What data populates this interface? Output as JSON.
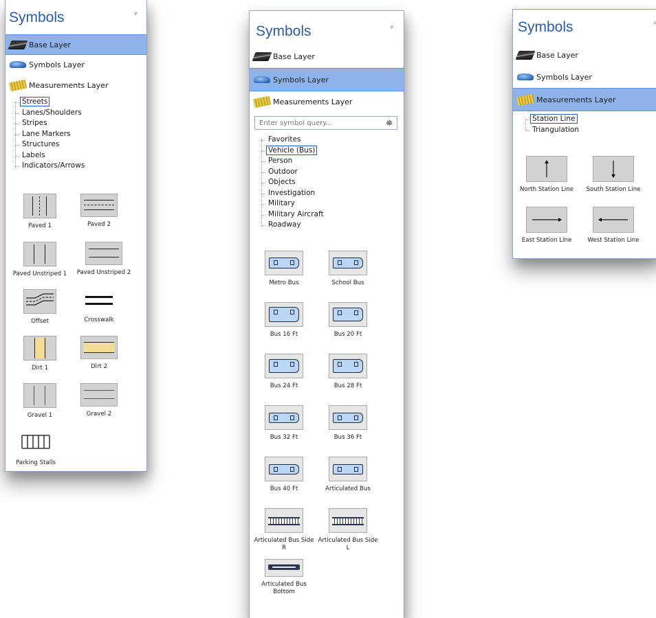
{
  "panel_left": {
    "title": "Symbols",
    "pin": "ᵖ",
    "layers": [
      "Base Layer",
      "Symbols Layer",
      "Measurements Layer"
    ],
    "selected_layer": "Base Layer",
    "tree": [
      "Streets",
      "Lanes/Shoulders",
      "Stripes",
      "Lane Markers",
      "Structures",
      "Labels",
      "Indicators/Arrows"
    ],
    "highlighted_item": "Streets",
    "symbols": [
      "Paved 1",
      "Paved 2",
      "Paved Unstriped 1",
      "Paved Unstriped 2",
      "Offset",
      "Crosswalk",
      "Dirt 1",
      "Dirt 2",
      "Gravel 1",
      "Gravel 2",
      "Parking Stalls"
    ]
  },
  "panel_middle": {
    "title": "Symbols",
    "pin": "ᵖ",
    "layers": [
      "Base Layer",
      "Symbols Layer",
      "Measurements Layer"
    ],
    "selected_layer": "Symbols Layer",
    "search_placeholder": "Enter symbol query...",
    "tree": [
      "Favorites",
      "Vehicle (Bus)",
      "Person",
      "Outdoor",
      "Objects",
      "Investigation",
      "Military",
      "Military Aircraft",
      "Roadway"
    ],
    "highlighted_item": "Vehicle (Bus)",
    "symbols": [
      "Metro Bus",
      "School Bus",
      "Bus 16 Ft",
      "Bus 20 Ft",
      "Bus 24 Ft",
      "Bus 28 Ft",
      "Bus 32 Ft",
      "Bus 36 Ft",
      "Bus 40 Ft",
      "Articulated Bus",
      "Articulated Bus Side R",
      "Articulated Bus Side L",
      "Articulated Bus Bottom"
    ]
  },
  "panel_right": {
    "title": "Symbols",
    "pin": "ᵖ",
    "layers": [
      "Base Layer",
      "Symbols Layer",
      "Measurements Layer"
    ],
    "selected_layer": "Measurements Layer",
    "tree": [
      "Station Line",
      "Triangulation"
    ],
    "highlighted_item": "Station Line",
    "symbols": [
      "North Station Line",
      "South Station Line",
      "East Station Line",
      "West Station Line"
    ]
  },
  "colors": {
    "title": "#2a5aa8",
    "selected_row": "#8db3e8",
    "highlight_box": "#2a55c0"
  }
}
